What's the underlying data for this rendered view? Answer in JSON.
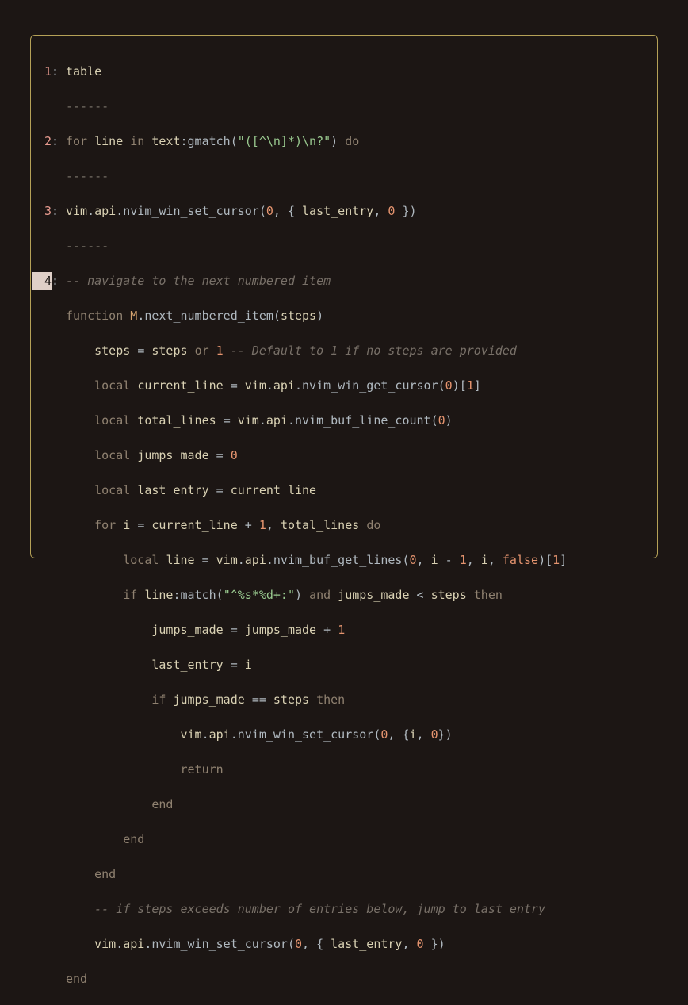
{
  "linenos": {
    "l1": "1",
    "l2": "2",
    "l3": "3",
    "l4": "4"
  },
  "punct": {
    "colon": ":"
  },
  "divider": "------",
  "entry1": {
    "l1": "table"
  },
  "entry2": {
    "kw_for": "for",
    "sp1": " ",
    "line": "line",
    "sp2": " ",
    "kw_in": "in",
    "sp3": " ",
    "text": "text",
    "colon": ":",
    "gmatch": "gmatch",
    "lp": "(",
    "str": "\"([^\\n]*)\\n?\"",
    "rp": ")",
    "sp4": " ",
    "kw_do": "do"
  },
  "entry3": {
    "vim": "vim",
    "d1": ".",
    "api": "api",
    "d2": ".",
    "fn": "nvim_win_set_cursor",
    "lp": "(",
    "zero": "0",
    "c1": ",",
    "sp1": " ",
    "lb": "{",
    "sp2": " ",
    "last_entry": "last_entry",
    "c2": ",",
    "sp3": " ",
    "zero2": "0",
    "sp4": " ",
    "rb": "}",
    "rp": ")"
  },
  "entry4": {
    "c1": "-- navigate to the next numbered item",
    "l2": {
      "kw_func": "function",
      "sp": " ",
      "M": "M",
      "d": ".",
      "fn": "next_numbered_item",
      "lp": "(",
      "steps": "steps",
      "rp": ")"
    },
    "l3": {
      "pad": "    ",
      "steps": "steps",
      "sp1": " ",
      "eq": "=",
      "sp2": " ",
      "steps2": "steps",
      "sp3": " ",
      "or": "or",
      "sp4": " ",
      "one": "1",
      "sp5": " ",
      "cmnt": "-- Default to 1 if no steps are provided"
    },
    "l4": {
      "pad": "    ",
      "local": "local",
      "sp1": " ",
      "cl": "current_line",
      "sp2": " ",
      "eq": "=",
      "sp3": " ",
      "vim": "vim",
      "d1": ".",
      "api": "api",
      "d2": ".",
      "fn": "nvim_win_get_cursor",
      "lp": "(",
      "zero": "0",
      "rp": ")",
      "lb": "[",
      "one": "1",
      "rb": "]"
    },
    "l5": {
      "pad": "    ",
      "local": "local",
      "sp1": " ",
      "tl": "total_lines",
      "sp2": " ",
      "eq": "=",
      "sp3": " ",
      "vim": "vim",
      "d1": ".",
      "api": "api",
      "d2": ".",
      "fn": "nvim_buf_line_count",
      "lp": "(",
      "zero": "0",
      "rp": ")"
    },
    "l6": {
      "pad": "    ",
      "local": "local",
      "sp1": " ",
      "jm": "jumps_made",
      "sp2": " ",
      "eq": "=",
      "sp3": " ",
      "zero": "0"
    },
    "l7": {
      "pad": "    ",
      "local": "local",
      "sp1": " ",
      "le": "last_entry",
      "sp2": " ",
      "eq": "=",
      "sp3": " ",
      "cl": "current_line"
    },
    "l8": {
      "pad": "    ",
      "for": "for",
      "sp1": " ",
      "i": "i",
      "sp2": " ",
      "eq": "=",
      "sp3": " ",
      "cl": "current_line",
      "sp4": " ",
      "plus": "+",
      "sp5": " ",
      "one": "1",
      "c": ",",
      "sp6": " ",
      "tl": "total_lines",
      "sp7": " ",
      "do": "do"
    },
    "l9": {
      "pad": "        ",
      "local": "local",
      "sp1": " ",
      "line": "line",
      "sp2": " ",
      "eq": "=",
      "sp3": " ",
      "vim": "vim",
      "d1": ".",
      "api": "api",
      "d2": ".",
      "fn": "nvim_buf_get_lines",
      "lp": "(",
      "zero": "0",
      "c1": ",",
      "sp4": " ",
      "i": "i",
      "sp5": " ",
      "minus": "-",
      "sp6": " ",
      "one": "1",
      "c2": ",",
      "sp7": " ",
      "i2": "i",
      "c3": ",",
      "sp8": " ",
      "false": "false",
      "rp": ")",
      "lb": "[",
      "one2": "1",
      "rb": "]"
    },
    "l10": {
      "pad": "        ",
      "if": "if",
      "sp1": " ",
      "line": "line",
      "colon": ":",
      "match": "match",
      "lp": "(",
      "str": "\"^%s*%d+:\"",
      "rp": ")",
      "sp2": " ",
      "and": "and",
      "sp3": " ",
      "jm": "jumps_made",
      "sp4": " ",
      "lt": "<",
      "sp5": " ",
      "steps": "steps",
      "sp6": " ",
      "then": "then"
    },
    "l11": {
      "pad": "            ",
      "jm": "jumps_made",
      "sp1": " ",
      "eq": "=",
      "sp2": " ",
      "jm2": "jumps_made",
      "sp3": " ",
      "plus": "+",
      "sp4": " ",
      "one": "1"
    },
    "l12": {
      "pad": "            ",
      "le": "last_entry",
      "sp1": " ",
      "eq": "=",
      "sp2": " ",
      "i": "i"
    },
    "l13": {
      "pad": "            ",
      "if": "if",
      "sp1": " ",
      "jm": "jumps_made",
      "sp2": " ",
      "eq": "==",
      "sp3": " ",
      "steps": "steps",
      "sp4": " ",
      "then": "then"
    },
    "l14": {
      "pad": "                ",
      "vim": "vim",
      "d1": ".",
      "api": "api",
      "d2": ".",
      "fn": "nvim_win_set_cursor",
      "lp": "(",
      "zero": "0",
      "c1": ",",
      "sp1": " ",
      "lb": "{",
      "i": "i",
      "c2": ",",
      "sp2": " ",
      "zero2": "0",
      "rb": "}",
      "rp": ")"
    },
    "l15": {
      "pad": "                ",
      "return": "return"
    },
    "l16": {
      "pad": "            ",
      "end": "end"
    },
    "l17": {
      "pad": "        ",
      "end": "end"
    },
    "l18": {
      "pad": "    ",
      "end": "end"
    },
    "l19": {
      "pad": "    ",
      "cmnt": "-- if steps exceeds number of entries below, jump to last entry"
    },
    "l20": {
      "pad": "    ",
      "vim": "vim",
      "d1": ".",
      "api": "api",
      "d2": ".",
      "fn": "nvim_win_set_cursor",
      "lp": "(",
      "zero": "0",
      "c1": ",",
      "sp1": " ",
      "lb": "{",
      "sp2": " ",
      "le": "last_entry",
      "c2": ",",
      "sp3": " ",
      "zero2": "0",
      "sp4": " ",
      "rb": "}",
      "rp": ")"
    },
    "l21": {
      "end": "end"
    }
  }
}
